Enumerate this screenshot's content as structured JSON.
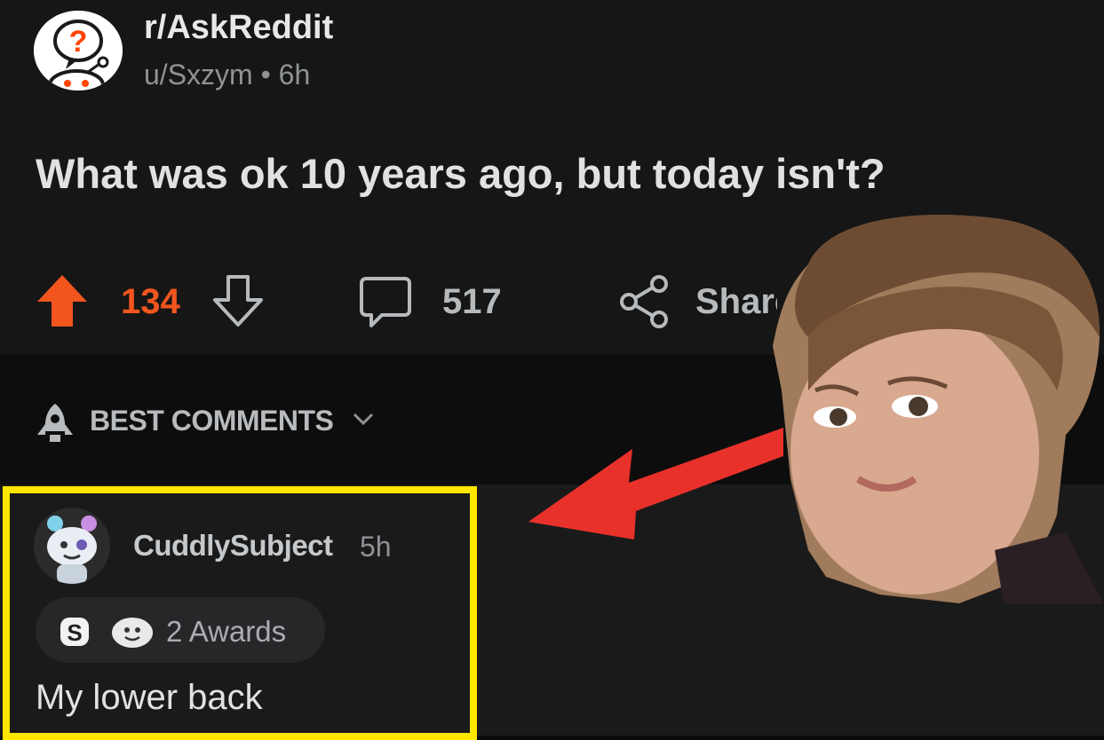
{
  "post": {
    "subreddit": "r/AskReddit",
    "meta": "u/Sxzym • 6h",
    "title": "What was ok 10 years ago, but today isn't?",
    "score": "134",
    "comments": "517",
    "share_label": "Share"
  },
  "sort": {
    "label": "BEST COMMENTS"
  },
  "comment": {
    "username": "CuddlySubject",
    "time": "5h",
    "awards_label": "2 Awards",
    "body": "My lower back"
  },
  "overlay": {
    "highlight_color": "#ffe600",
    "arrow_color": "#e8312a"
  },
  "colors": {
    "upvote": "#f2551e",
    "background": "#161616"
  }
}
